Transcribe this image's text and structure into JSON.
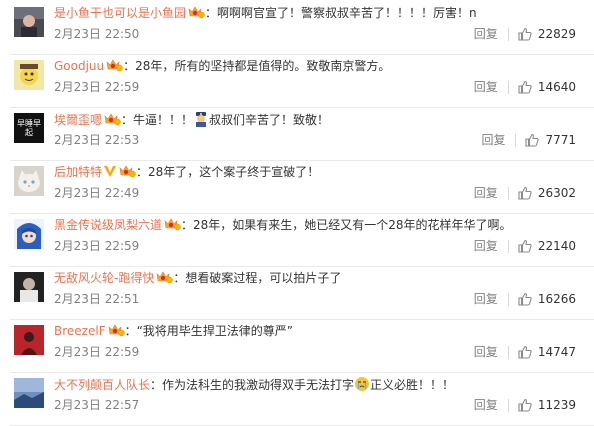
{
  "comments": [
    {
      "username": "是小鱼干也可以是小鱼园",
      "name_color": "orange",
      "badges": [
        "vip-badge"
      ],
      "text": "：啊啊啊官宣了！警察叔叔辛苦了！！！！厉害！n",
      "inline_emoji": "",
      "text_after_emoji": "",
      "time": "2月23日 22:50",
      "reply": "回复",
      "likes": "22829",
      "avatar": "dark-figure"
    },
    {
      "username": "Goodjuu",
      "name_color": "orange",
      "badges": [
        "vip-badge"
      ],
      "text": "：28年，所有的坚持都是值得的。致敬南京警方。",
      "inline_emoji": "",
      "text_after_emoji": "",
      "time": "2月23日 22:59",
      "reply": "回复",
      "likes": "14640",
      "avatar": "yellow-cartoon"
    },
    {
      "username": "埃爾歪嗯",
      "name_color": "orange",
      "badges": [
        "vip-badge"
      ],
      "text": "：牛逼！！！",
      "inline_emoji": "police-emoji",
      "text_after_emoji": "叔叔们辛苦了！致敬！",
      "time": "2月23日 22:53",
      "reply": "回复",
      "likes": "7771",
      "avatar": "black-text",
      "avatar_text": "早睡早起"
    },
    {
      "username": "后加特特",
      "name_color": "orange",
      "badges": [
        "verified-badge",
        "vip-badge"
      ],
      "text": "：28年了，这个案子终于宣破了！",
      "inline_emoji": "",
      "text_after_emoji": "",
      "time": "2月23日 22:49",
      "reply": "回复",
      "likes": "26302",
      "avatar": "white-cat"
    },
    {
      "username": "黑金传说级凤梨六道",
      "name_color": "orange",
      "badges": [
        "vip-badge"
      ],
      "text": "：28年，如果有来生，她已经又有一个28年的花样年华了啊。",
      "inline_emoji": "",
      "text_after_emoji": "",
      "time": "2月23日 22:59",
      "reply": "回复",
      "likes": "22140",
      "avatar": "blue-anime"
    },
    {
      "username": "无敌风火轮-跑得快",
      "name_color": "orange",
      "badges": [
        "vip-badge"
      ],
      "text": "：想看破案过程，可以拍片子了",
      "inline_emoji": "",
      "text_after_emoji": "",
      "time": "2月23日 22:51",
      "reply": "回复",
      "likes": "16266",
      "avatar": "basketball-24"
    },
    {
      "username": "BreezelF",
      "name_color": "orange",
      "badges": [
        "vip-badge"
      ],
      "text": "：“我将用毕生捍卫法律的尊严”",
      "inline_emoji": "",
      "text_after_emoji": "",
      "time": "2月23日 22:59",
      "reply": "回复",
      "likes": "14747",
      "avatar": "red-figure"
    },
    {
      "username": "大不列颠百人队长",
      "name_color": "orange",
      "badges": [],
      "text": "：作为法科生的我激动得双手无法打字",
      "inline_emoji": "crying-emoji",
      "text_after_emoji": "正义必胜！！！",
      "time": "2月23日 22:57",
      "reply": "回复",
      "likes": "11239",
      "avatar": "blue-sky"
    }
  ],
  "colors": {
    "username": "#eb7350",
    "text": "#333333",
    "meta": "#808080",
    "vip_badge": "#f7a631",
    "verified_badge": "#ffa500"
  }
}
